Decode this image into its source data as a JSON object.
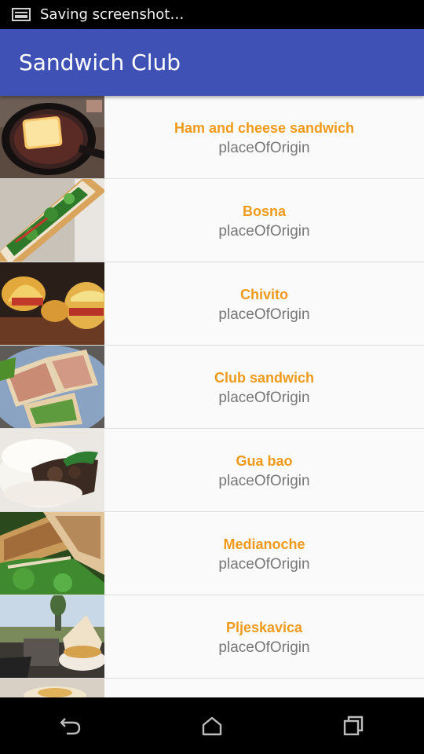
{
  "status_bar": {
    "text": "Saving screenshot…",
    "icon": "screenshot-icon"
  },
  "app_bar": {
    "title": "Sandwich Club",
    "color": "#3f51b5"
  },
  "accent_color": "#ef9a1a",
  "sandwiches": [
    {
      "name": "Ham and cheese sandwich",
      "origin": "placeOfOrigin",
      "image": "grilled-cheese-in-pan"
    },
    {
      "name": "Bosna",
      "origin": "placeOfOrigin",
      "image": "bosna-hotdog-with-greens"
    },
    {
      "name": "Chivito",
      "origin": "placeOfOrigin",
      "image": "chivito-sandwiches"
    },
    {
      "name": "Club sandwich",
      "origin": "placeOfOrigin",
      "image": "club-sandwich-plate"
    },
    {
      "name": "Gua bao",
      "origin": "placeOfOrigin",
      "image": "gua-bao-bun"
    },
    {
      "name": "Medianoche",
      "origin": "placeOfOrigin",
      "image": "medianoche-pressed-sandwich"
    },
    {
      "name": "Pljeskavica",
      "origin": "placeOfOrigin",
      "image": "pljeskavica-outdoor-table"
    }
  ],
  "nav_bar": {
    "back_icon": "back-icon",
    "home_icon": "home-icon",
    "recents_icon": "recents-icon"
  }
}
